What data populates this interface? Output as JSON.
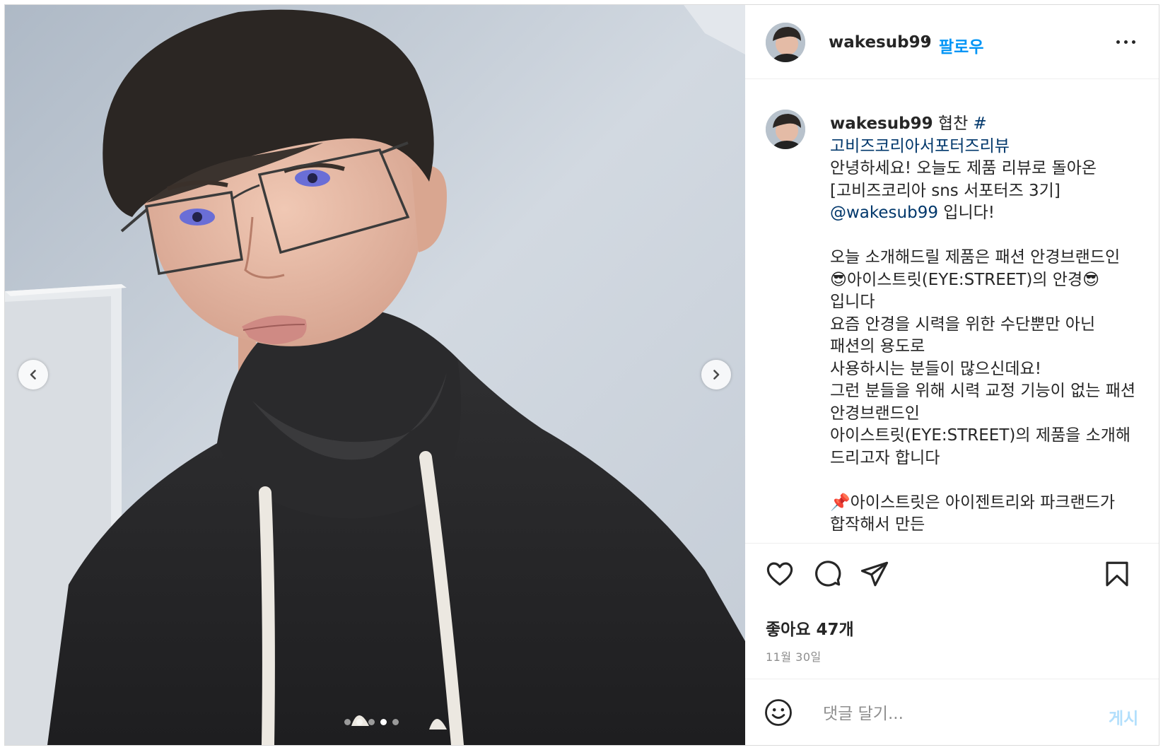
{
  "post": {
    "username": "wakesub99",
    "follow_label": "팔로우",
    "separator": "•",
    "carousel": {
      "slide_count": 5,
      "active_slide": 4
    }
  },
  "caption": {
    "username": "wakesub99",
    "prefix": " 협찬 ",
    "hashtag": "#고비즈코리아서포터즈리뷰",
    "line1": "안녕하세요! 오늘도 제품 리뷰로 돌아온 [고비즈코리아 sns 서포터즈 3기] ",
    "mention": "@wakesub99",
    "line2": " 입니다!\n\n오늘 소개해드릴 제품은 패션 안경브랜드인\n😎아이스트릿(EYE:STREET)의 안경😎입니다\n요즘 안경을 시력을 위한 수단뿐만 아닌 패션의 용도로\n사용하시는 분들이 많으신데요!\n그런 분들을 위해 시력 교정 기능이 없는 패션 안경브랜드인\n아이스트릿(EYE:STREET)의 제품을 소개해 드리고자 합니다\n\n📌아이스트릿은 아이젠트리와 파크랜드가 합작해서 만든"
  },
  "engagement": {
    "likes": "좋아요 47개",
    "date": "11월 30일"
  },
  "comment": {
    "placeholder": "댓글 달기...",
    "post_label": "게시"
  },
  "icons": {
    "prev": "chevron-left-icon",
    "next": "chevron-right-icon",
    "like": "heart-icon",
    "comment": "comment-icon",
    "share": "paper-plane-icon",
    "save": "bookmark-icon",
    "emoji": "smiley-icon",
    "more": "ellipsis-icon"
  },
  "colors": {
    "accent": "#0095f6",
    "link": "#00376b",
    "post_disabled": "#b2dffc",
    "muted": "#8e8e8e"
  }
}
